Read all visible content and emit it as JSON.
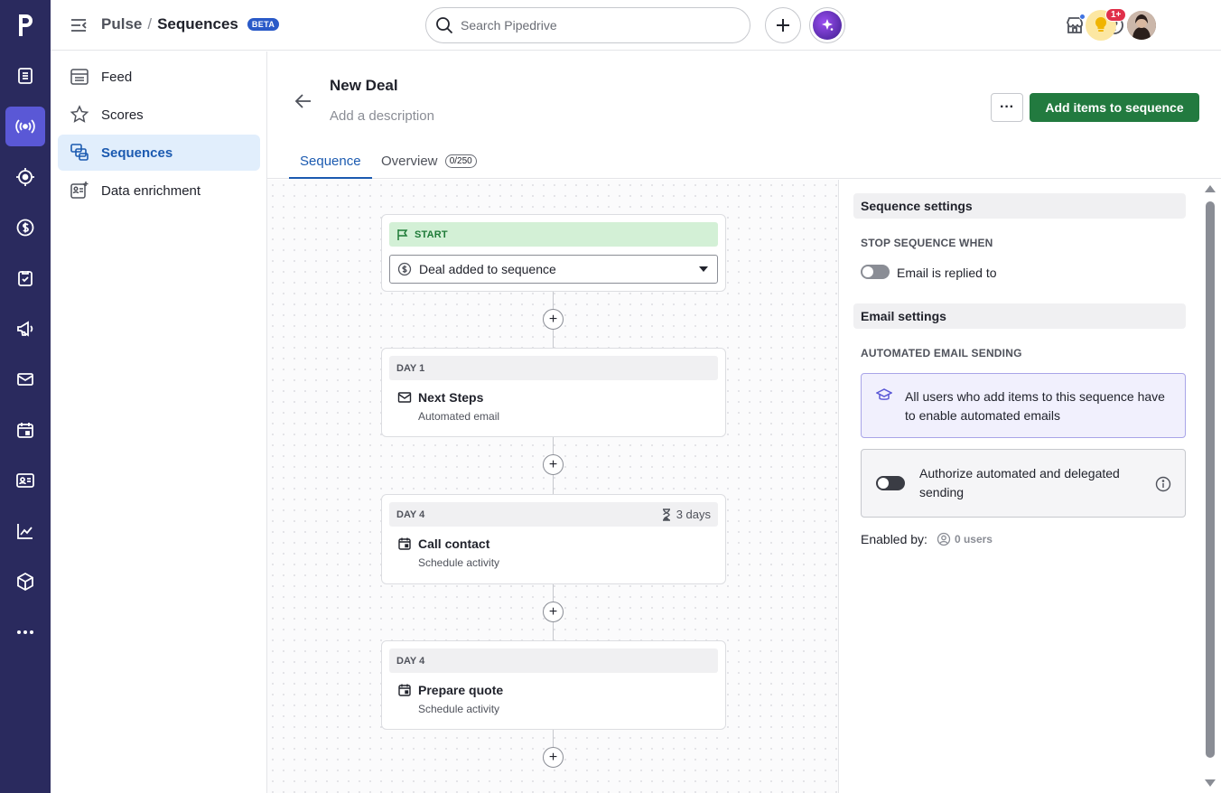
{
  "rail": {
    "logo": "p",
    "items": [
      {
        "icon": "deals-list-icon"
      },
      {
        "icon": "pulse-broadcast-icon",
        "active": true
      },
      {
        "icon": "leads-target-icon"
      },
      {
        "icon": "dollar-icon"
      },
      {
        "icon": "tasks-icon"
      },
      {
        "icon": "megaphone-icon"
      },
      {
        "icon": "mail-icon"
      },
      {
        "icon": "calendar-icon"
      },
      {
        "icon": "contacts-card-icon"
      },
      {
        "icon": "insights-chart-icon"
      },
      {
        "icon": "products-box-icon"
      },
      {
        "icon": "more-icon"
      }
    ]
  },
  "header": {
    "crumb_parent": "Pulse",
    "crumb_sep": "/",
    "crumb_current": "Sequences",
    "beta": "BETA",
    "search_placeholder": "Search Pipedrive",
    "notification_badge": "1+"
  },
  "subnav": {
    "items": [
      {
        "label": "Feed"
      },
      {
        "label": "Scores"
      },
      {
        "label": "Sequences",
        "active": true
      },
      {
        "label": "Data enrichment"
      }
    ]
  },
  "main": {
    "title": "New Deal",
    "description_placeholder": "Add a description",
    "more_label": "···",
    "primary_button": "Add items to sequence",
    "tabs": [
      {
        "label": "Sequence",
        "active": true
      },
      {
        "label": "Overview",
        "count": "0/250"
      }
    ]
  },
  "sequence": {
    "start_label": "START",
    "trigger": "Deal added to sequence",
    "steps": [
      {
        "day": "DAY 1",
        "title": "Next Steps",
        "subtitle": "Automated email",
        "icon": "mail-icon",
        "wait": ""
      },
      {
        "day": "DAY 4",
        "title": "Call contact",
        "subtitle": "Schedule activity",
        "icon": "calendar-icon",
        "wait": "3 days"
      },
      {
        "day": "DAY 4",
        "title": "Prepare quote",
        "subtitle": "Schedule activity",
        "icon": "calendar-icon",
        "wait": ""
      }
    ],
    "add_label": "+"
  },
  "settings": {
    "sequence_heading": "Sequence settings",
    "stop_label": "STOP SEQUENCE WHEN",
    "stop_toggle_label": "Email is replied to",
    "stop_toggle_on": false,
    "email_heading": "Email settings",
    "auto_label": "AUTOMATED EMAIL SENDING",
    "info_text": "All users who add items to this sequence have to enable automated emails",
    "auth_text": "Authorize automated and delegated sending",
    "auth_toggle_on": false,
    "enabled_label": "Enabled by:",
    "enabled_users": "0 users"
  },
  "colors": {
    "rail_bg": "#2a2a5e",
    "rail_active": "#5a58d6",
    "primary_green": "#227a3f",
    "link_blue": "#1b5ab0"
  }
}
